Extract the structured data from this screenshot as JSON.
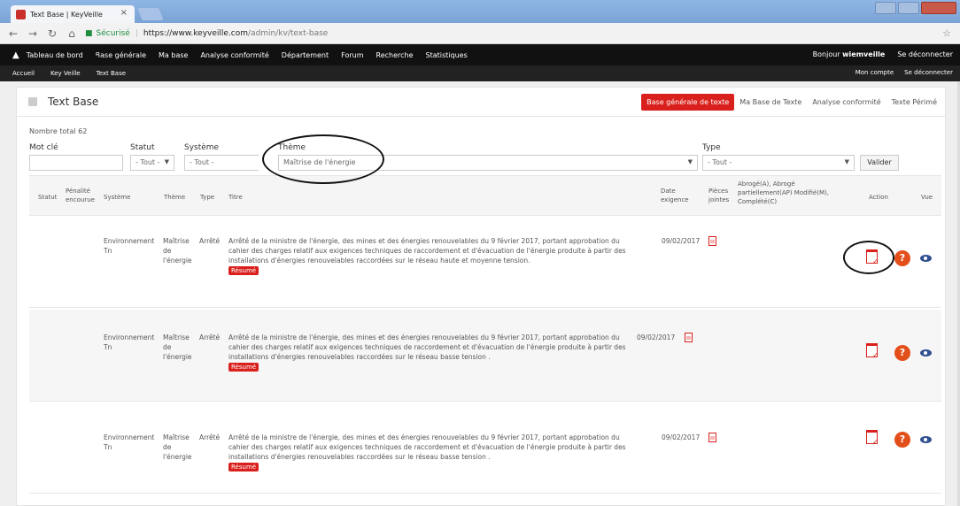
{
  "browser": {
    "tab_title": "Text Base | KeyVeille",
    "tab_close": "×",
    "secure_label": "Sécurisé",
    "url_host": "https://www.keyveille.com",
    "url_path": "/admin/kv/text-base"
  },
  "nav_primary": {
    "items": [
      "Tableau de bord",
      "Base générale",
      "Ma base",
      "Analyse conformité",
      "Département",
      "Forum",
      "Recherche",
      "Statistiques"
    ],
    "greeting_prefix": "Bonjour ",
    "username": "wiemveille",
    "logout": "Se déconnecter"
  },
  "nav_secondary": {
    "items": [
      "Accueil",
      "Key Veille",
      "Text Base"
    ],
    "account": "Mon compte",
    "logout": "Se déconnecter"
  },
  "page": {
    "title": "Text Base",
    "tabs": [
      "Base générale de texte",
      "Ma Base de Texte",
      "Analyse conformité",
      "Texte Périmé"
    ],
    "active_tab": 0,
    "total_label": "Nombre total 62"
  },
  "filters": {
    "mot_cle_label": "Mot clé",
    "mot_cle_value": "",
    "statut_label": "Statut",
    "statut_value": "- Tout -",
    "systeme_label": "Système",
    "systeme_value": "- Tout -",
    "theme_label": "Thème",
    "theme_value": "Maîtrise de l'énergie",
    "type_label": "Type",
    "type_value": "- Tout -",
    "submit": "Valider"
  },
  "table": {
    "headers": {
      "statut": "Statut",
      "penalite_1": "Pénalité",
      "penalite_2": "encourue",
      "systeme": "Système",
      "theme": "Thème",
      "type": "Type",
      "titre": "Titre",
      "date_1": "Date",
      "date_2": "exigence",
      "pieces_1": "Pièces",
      "pieces_2": "jointes",
      "abroge_1": "Abrogé(A), Abrogé",
      "abroge_2": "partiellement(AP) Modifié(M),",
      "abroge_3": "Complété(C)",
      "action": "Action",
      "vue": "Vue"
    },
    "rows": [
      {
        "systeme_1": "Environnement",
        "systeme_2": "Tn",
        "theme_1": "Maîtrise",
        "theme_2": "de",
        "theme_3": "l'énergie",
        "type": "Arrêté",
        "titre_1": "Arrêté de la ministre de l'énergie, des mines et des énergies renouvelables du 9 février 2017, portant approbation du",
        "titre_2": "cahier des charges relatif aux exigences techniques de raccordement et d'évacuation de l'énergie produite à partir des",
        "titre_3": "installations d'énergies renouvelables raccordées sur le réseau haute et moyenne tension.",
        "resume": "Résumé",
        "date": "09/02/2017",
        "help": "?"
      },
      {
        "systeme_1": "Environnement",
        "systeme_2": "Tn",
        "theme_1": "Maîtrise",
        "theme_2": "de",
        "theme_3": "l'énergie",
        "type": "Arrêté",
        "titre_1": "Arrêté de la ministre de l'énergie, des mines et des énergies renouvelables du 9 février 2017, portant approbation du",
        "titre_2": "cahier des charges relatif aux exigences techniques de raccordement et d'évacuation de l'énergie produite à partir des",
        "titre_3": "installations d'énergies renouvelables raccordées sur le réseau basse tension .",
        "resume": "Résumé",
        "date": "09/02/2017",
        "help": "?"
      },
      {
        "systeme_1": "Environnement",
        "systeme_2": "Tn",
        "theme_1": "Maîtrise",
        "theme_2": "de",
        "theme_3": "l'énergie",
        "type": "Arrêté",
        "titre_1": "Arrêté de la ministre de l'énergie, des mines et des énergies renouvelables du 9 février 2017, portant approbation du",
        "titre_2": "cahier des charges relatif aux exigences techniques de raccordement et d'évacuation de l'énergie produite à partir des",
        "titre_3": "installations d'énergies renouvelables raccordées sur le réseau basse tension .",
        "resume": "Résumé",
        "date": "09/02/2017",
        "help": "?"
      }
    ]
  },
  "colors": {
    "accent": "#d9201c",
    "navbar": "#111111",
    "help": "#e34f1a",
    "eye": "#2f4f8f"
  }
}
